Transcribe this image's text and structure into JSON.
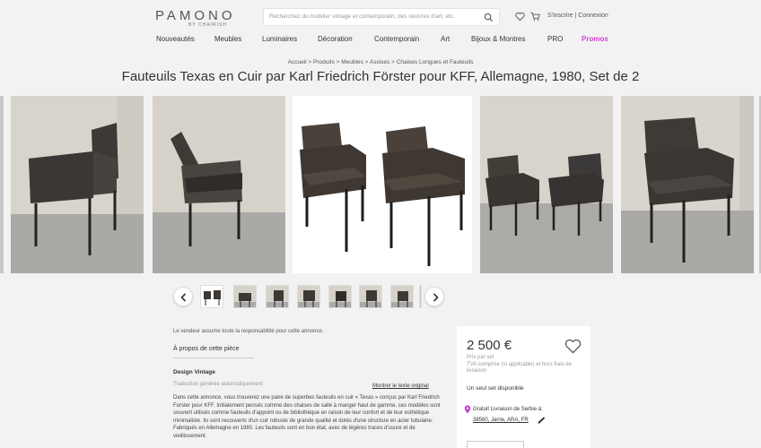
{
  "header": {
    "logo": "PAMONO",
    "logo_sub": "BY CHAIRISH",
    "search_placeholder": "Recherchez du mobilier vintage et contemporain, des oeuvres d'art, etc.",
    "auth": "S'inscrire | Connexion"
  },
  "nav": {
    "items": [
      "Nouveautés",
      "Meubles",
      "Luminaires",
      "Décoration",
      "Contemporain",
      "Art",
      "Bijoux & Montres",
      "PRO",
      "Promos"
    ]
  },
  "breadcrumb": "Accueil > Produits > Meubles > Assises > Chaises Longues et Fauteuils",
  "product": {
    "title": "Fauteuils Texas en Cuir par Karl Friedrich Förster pour KFF, Allemagne, 1980, Set de 2"
  },
  "description": {
    "seller_note": "Le vendeur assume toute la responsabilité pour cette annonce.",
    "about_heading": "À propos de cette pièce",
    "seller": "Design Vintage",
    "auto_translation": "Traduction générée automatiquement",
    "show_original": "Montrer le texte original",
    "body": "Dans cette annonce, vous trouverez une paire de superbes fauteuils en cuir « Texas » conçus par Karl Friedrich Forster pour KFF. Initialement pensés comme des chaises de salle à manger haut de gamme, ces modèles sont souvent utilisés comme fauteuils d'appoint ou de bibliothèque en raison de leur confort et de leur esthétique minimaliste. Ils sont recouverts d'un cuir robuste de grande qualité et dotés d'une structure en acier tubulaire. Fabriqués en Allemagne en 1980. Les fauteuils sont en bon état, avec de légères traces d'usure et de vieillissement."
  },
  "purchase": {
    "price": "2 500 €",
    "price_per": "Prix par set",
    "tva": "TVA comprise (si applicable) et hors frais de livraison",
    "stock": "Un seul set disponible",
    "delivery": "Gratuit Livraison de Serbie à:",
    "zip": "38560, Jarrie, ARA, FR"
  },
  "colors": {
    "accent_promo": "#d63fd8",
    "background": "#f2f2f2"
  }
}
